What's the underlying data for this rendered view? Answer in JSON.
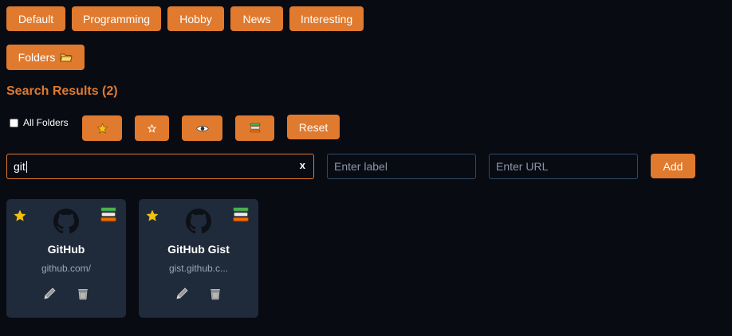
{
  "folders": {
    "tabs": [
      "Default",
      "Programming",
      "Hobby",
      "News",
      "Interesting"
    ],
    "folders_button": "Folders",
    "folders_icon": "folder-icon"
  },
  "search": {
    "title": "Search Results (2)",
    "all_folders_label": "All Folders",
    "all_folders_checked": false,
    "filter_buttons": [
      "star-filled-icon",
      "star-outline-icon",
      "eye-icon",
      "books-icon"
    ],
    "reset_label": "Reset",
    "query": "git",
    "clear_label": "x"
  },
  "add_form": {
    "label_placeholder": "Enter label",
    "url_placeholder": "Enter URL",
    "add_label": "Add"
  },
  "bookmarks": [
    {
      "name": "GitHub",
      "url": "github.com/",
      "starred": true,
      "icon": "github-icon"
    },
    {
      "name": "GitHub Gist",
      "url": "gist.github.c...",
      "starred": true,
      "icon": "github-icon"
    }
  ],
  "colors": {
    "accent": "#e07a2e",
    "background": "#090b13",
    "card": "#1f2a3b",
    "star": "#f4c20d"
  }
}
